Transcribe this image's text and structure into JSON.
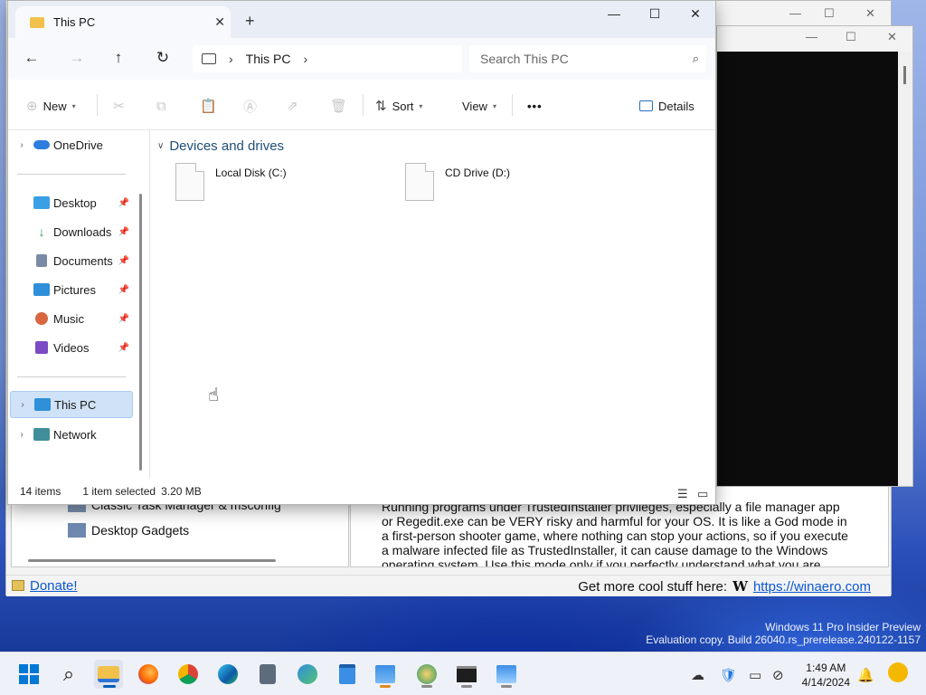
{
  "desktop": {
    "watermark_line1": "Windows 11 Pro Insider Preview",
    "watermark_line2": "Evaluation copy. Build 26040.rs_prerelease.240122-1157"
  },
  "winaero": {
    "items": [
      "Classic Task Manager & msconfig",
      "Desktop Gadgets"
    ],
    "description": "Running programs under TrustedInstaller privileges, especially a file manager app or Regedit.exe can be VERY risky and harmful for your OS. It is like a God mode in a first-person shooter game, where nothing can stop your actions, so if you execute a malware infected file as TrustedInstaller, it can cause damage to the Windows operating system. Use this mode only if you perfectly understand what you are doing",
    "donate": "Donate!",
    "get_more": "Get more cool stuff here:",
    "w_logo": "W",
    "link": "https://winaero.com"
  },
  "explorer": {
    "tab_title": "This PC",
    "new_tab": "+",
    "minimize": "—",
    "maximize": "☐",
    "close": "✕",
    "breadcrumb": [
      "This PC"
    ],
    "search_placeholder": "Search This PC",
    "toolbar": {
      "new_label": "New",
      "sort_label": "Sort",
      "view_label": "View",
      "more_label": "•••",
      "details_label": "Details"
    },
    "sidebar": {
      "onedrive": "OneDrive",
      "quick": [
        {
          "label": "Desktop",
          "icon": "desktop-icon",
          "color": "#3aa0e6"
        },
        {
          "label": "Downloads",
          "icon": "downloads-icon",
          "color": "#2e9a5c"
        },
        {
          "label": "Documents",
          "icon": "documents-icon",
          "color": "#7a8aa6"
        },
        {
          "label": "Pictures",
          "icon": "pictures-icon",
          "color": "#2f8fd8"
        },
        {
          "label": "Music",
          "icon": "music-icon",
          "color": "#d9663f"
        },
        {
          "label": "Videos",
          "icon": "videos-icon",
          "color": "#7a4bc4"
        }
      ],
      "this_pc": "This PC",
      "network": "Network"
    },
    "group_header": "Devices and drives",
    "drives": [
      {
        "name": "Local Disk (C:)"
      },
      {
        "name": "CD Drive (D:)"
      }
    ],
    "status": {
      "count": "14 items",
      "selected": "1 item selected",
      "size": "3.20 MB"
    }
  },
  "taskbar": {
    "time": "1:49 AM",
    "date": "4/14/2024"
  },
  "colors": {
    "accent": "#005fb8",
    "selection": "#cfe2f7",
    "group_header": "#1f4e79",
    "link": "#0b57d0"
  }
}
